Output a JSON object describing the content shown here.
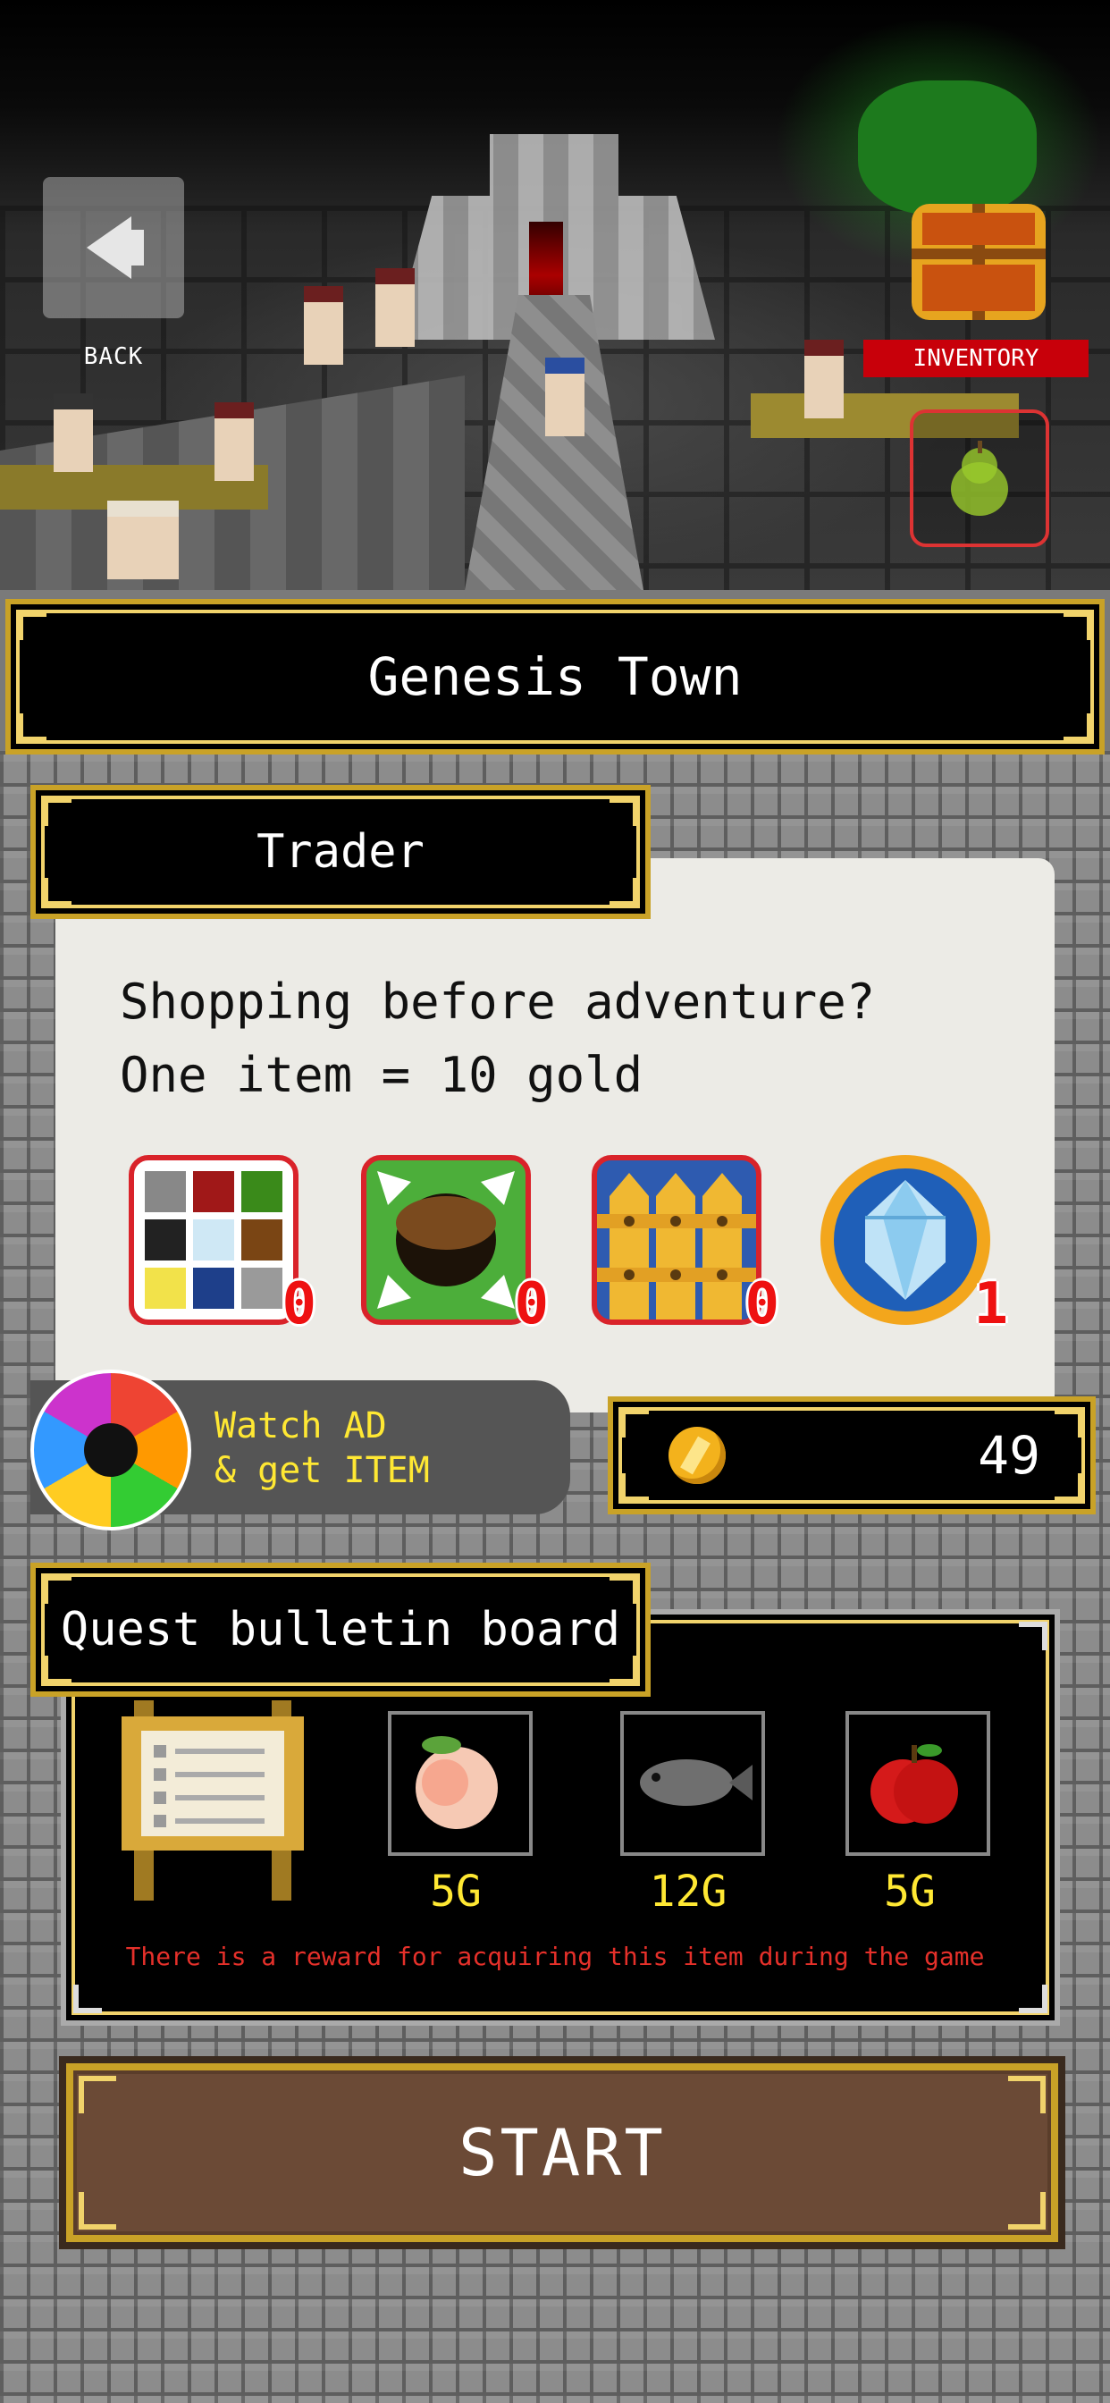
{
  "top": {
    "back_label": "BACK",
    "inventory_label": "INVENTORY"
  },
  "location": {
    "title": "Genesis Town"
  },
  "trader": {
    "header": "Trader",
    "message_line1": "Shopping before adventure?",
    "message_line2": "One item = 10 gold",
    "items": [
      {
        "icon": "blocks-icon",
        "count": "0"
      },
      {
        "icon": "hole-icon",
        "count": "0"
      },
      {
        "icon": "fence-icon",
        "count": "0"
      },
      {
        "icon": "crystal-icon",
        "count": "1"
      }
    ]
  },
  "ad": {
    "line1": "Watch AD",
    "line2": "& get ITEM"
  },
  "gold": {
    "amount": "49"
  },
  "quest": {
    "header": "Quest bulletin board",
    "items": [
      {
        "icon": "peach-icon",
        "price": "5G"
      },
      {
        "icon": "fish-icon",
        "price": "12G"
      },
      {
        "icon": "apple-icon",
        "price": "5G"
      }
    ],
    "note": "There is a reward for acquiring this item during the game"
  },
  "start": {
    "label": "START"
  },
  "colors": {
    "frame_gold": "#c9a227",
    "inventory_red": "#c8000a",
    "price_yellow": "#ffe833",
    "note_red": "#e5302a"
  }
}
